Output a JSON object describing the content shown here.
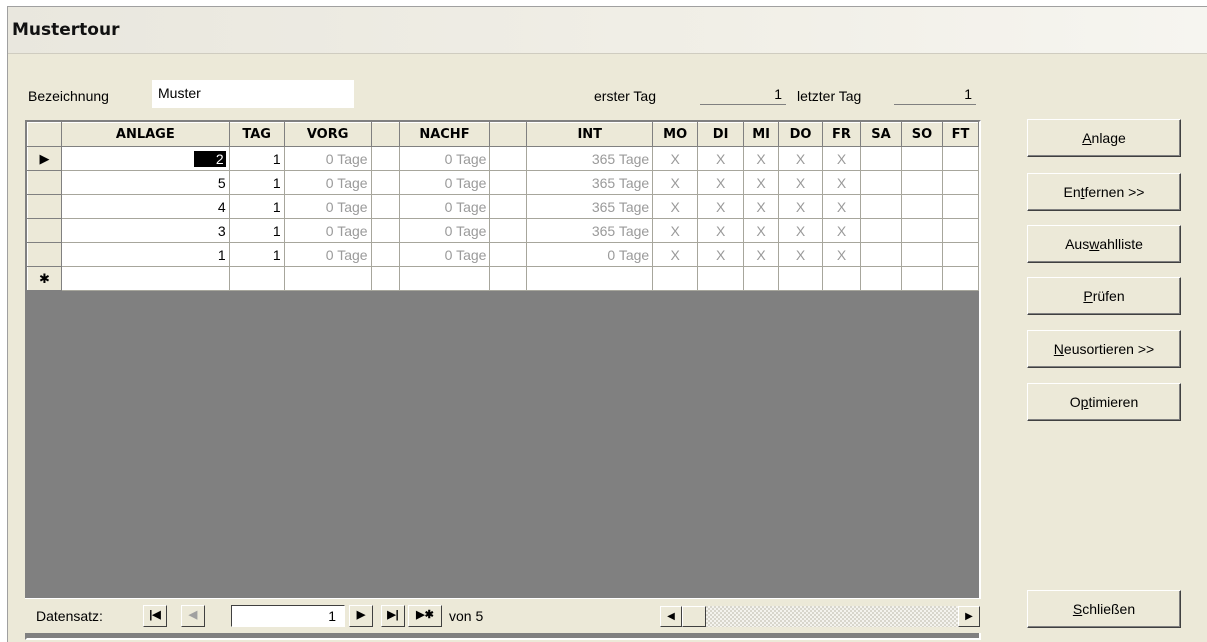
{
  "window": {
    "title": "Mustertour"
  },
  "form": {
    "bezeichnung_label": "Bezeichnung",
    "bezeichnung_value": "Muster",
    "erster_tag_label": "erster Tag",
    "erster_tag_value": "1",
    "letzter_tag_label": "letzter Tag",
    "letzter_tag_value": "1"
  },
  "grid": {
    "columns": [
      "ANLAGE",
      "TAG",
      "VORG",
      "",
      "NACHF",
      "",
      "INT",
      "MO",
      "DI",
      "MI",
      "DO",
      "FR",
      "SA",
      "SO",
      "FT"
    ],
    "rows": [
      {
        "anlage": "2",
        "tag": "1",
        "vorg": "0 Tage",
        "nachf": "0 Tage",
        "int": "365 Tage",
        "mo": "X",
        "di": "X",
        "mi": "X",
        "do": "X",
        "fr": "X",
        "sa": "",
        "so": "",
        "ft": ""
      },
      {
        "anlage": "5",
        "tag": "1",
        "vorg": "0 Tage",
        "nachf": "0 Tage",
        "int": "365 Tage",
        "mo": "X",
        "di": "X",
        "mi": "X",
        "do": "X",
        "fr": "X",
        "sa": "",
        "so": "",
        "ft": ""
      },
      {
        "anlage": "4",
        "tag": "1",
        "vorg": "0 Tage",
        "nachf": "0 Tage",
        "int": "365 Tage",
        "mo": "X",
        "di": "X",
        "mi": "X",
        "do": "X",
        "fr": "X",
        "sa": "",
        "so": "",
        "ft": ""
      },
      {
        "anlage": "3",
        "tag": "1",
        "vorg": "0 Tage",
        "nachf": "0 Tage",
        "int": "365 Tage",
        "mo": "X",
        "di": "X",
        "mi": "X",
        "do": "X",
        "fr": "X",
        "sa": "",
        "so": "",
        "ft": ""
      },
      {
        "anlage": "1",
        "tag": "1",
        "vorg": "0 Tage",
        "nachf": "0 Tage",
        "int": "0 Tage",
        "mo": "X",
        "di": "X",
        "mi": "X",
        "do": "X",
        "fr": "X",
        "sa": "",
        "so": "",
        "ft": ""
      }
    ],
    "current_row_marker": "▶",
    "new_row_marker": "✱"
  },
  "navigation": {
    "label": "Datensatz:",
    "current": "1",
    "total_text": "von 5",
    "first": "|◀",
    "prev": "◀",
    "next": "▶",
    "last": "▶|",
    "new": "▶✱"
  },
  "buttons": {
    "anlage": {
      "accel": "A",
      "rest": "nlage"
    },
    "entfernen": {
      "pre": "En",
      "accel": "t",
      "rest": "fernen >>"
    },
    "auswahlliste": {
      "pre": "Aus",
      "accel": "w",
      "rest": "ahlliste"
    },
    "pruefen": {
      "accel": "P",
      "rest": "rüfen"
    },
    "neusortieren": {
      "accel": "N",
      "rest": "eusortieren >>"
    },
    "optimieren": {
      "pre": "O",
      "accel": "p",
      "rest": "timieren"
    },
    "schliessen": {
      "accel": "S",
      "rest": "chließen"
    }
  }
}
